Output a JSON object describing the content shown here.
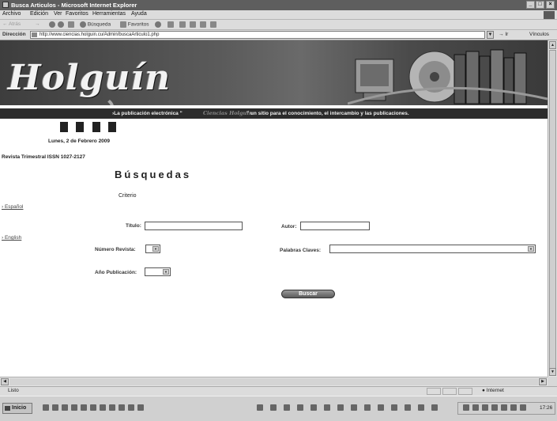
{
  "window": {
    "title": "Busca Articulos - Microsoft Internet Explorer",
    "controls": [
      "_",
      "□",
      "×"
    ]
  },
  "menu": [
    "Archivo",
    "Edición",
    "Ver",
    "Favoritos",
    "Herramientas",
    "Ayuda"
  ],
  "toolbar": {
    "back_label": "Atrás",
    "search_label": "Búsqueda",
    "favorites_label": "Favoritos"
  },
  "address": {
    "label": "Dirección",
    "url": "http://www.ciencias.holguin.cu/Admin/buscaArticulo1.php",
    "go_label": "Ir",
    "links_label": "Vínculos"
  },
  "page": {
    "logo_text": "Holguín",
    "tagline_pre": "›La publicación electrónica \"",
    "tagline_name": "Ciencias Holguín",
    "tagline_post": "\" un sitio para el conocimiento, el intercambio y las publicaciones.",
    "date": "Lunes, 2 de Febrero 2009",
    "issn": "Revista Trimestral ISSN 1027-2127",
    "heading": "Búsquedas",
    "criteria_label": "Criterio",
    "lang_links": [
      "› Español",
      "› English"
    ],
    "form": {
      "titulo_label": "Título:",
      "autor_label": "Autor:",
      "numero_label": "Número Revista:",
      "palabras_label": "Palabras Claves:",
      "anio_label": "Año Publicación:",
      "buscar_label": "Buscar"
    }
  },
  "status": {
    "text": "Listo",
    "zone": "Internet"
  },
  "taskbar": {
    "start_label": "Inicio",
    "clock": "17:26"
  },
  "colors": {
    "banner_dark": "#2c2c2c",
    "page_bg": "#ffffff",
    "chrome_bg": "#dcdcdc"
  }
}
